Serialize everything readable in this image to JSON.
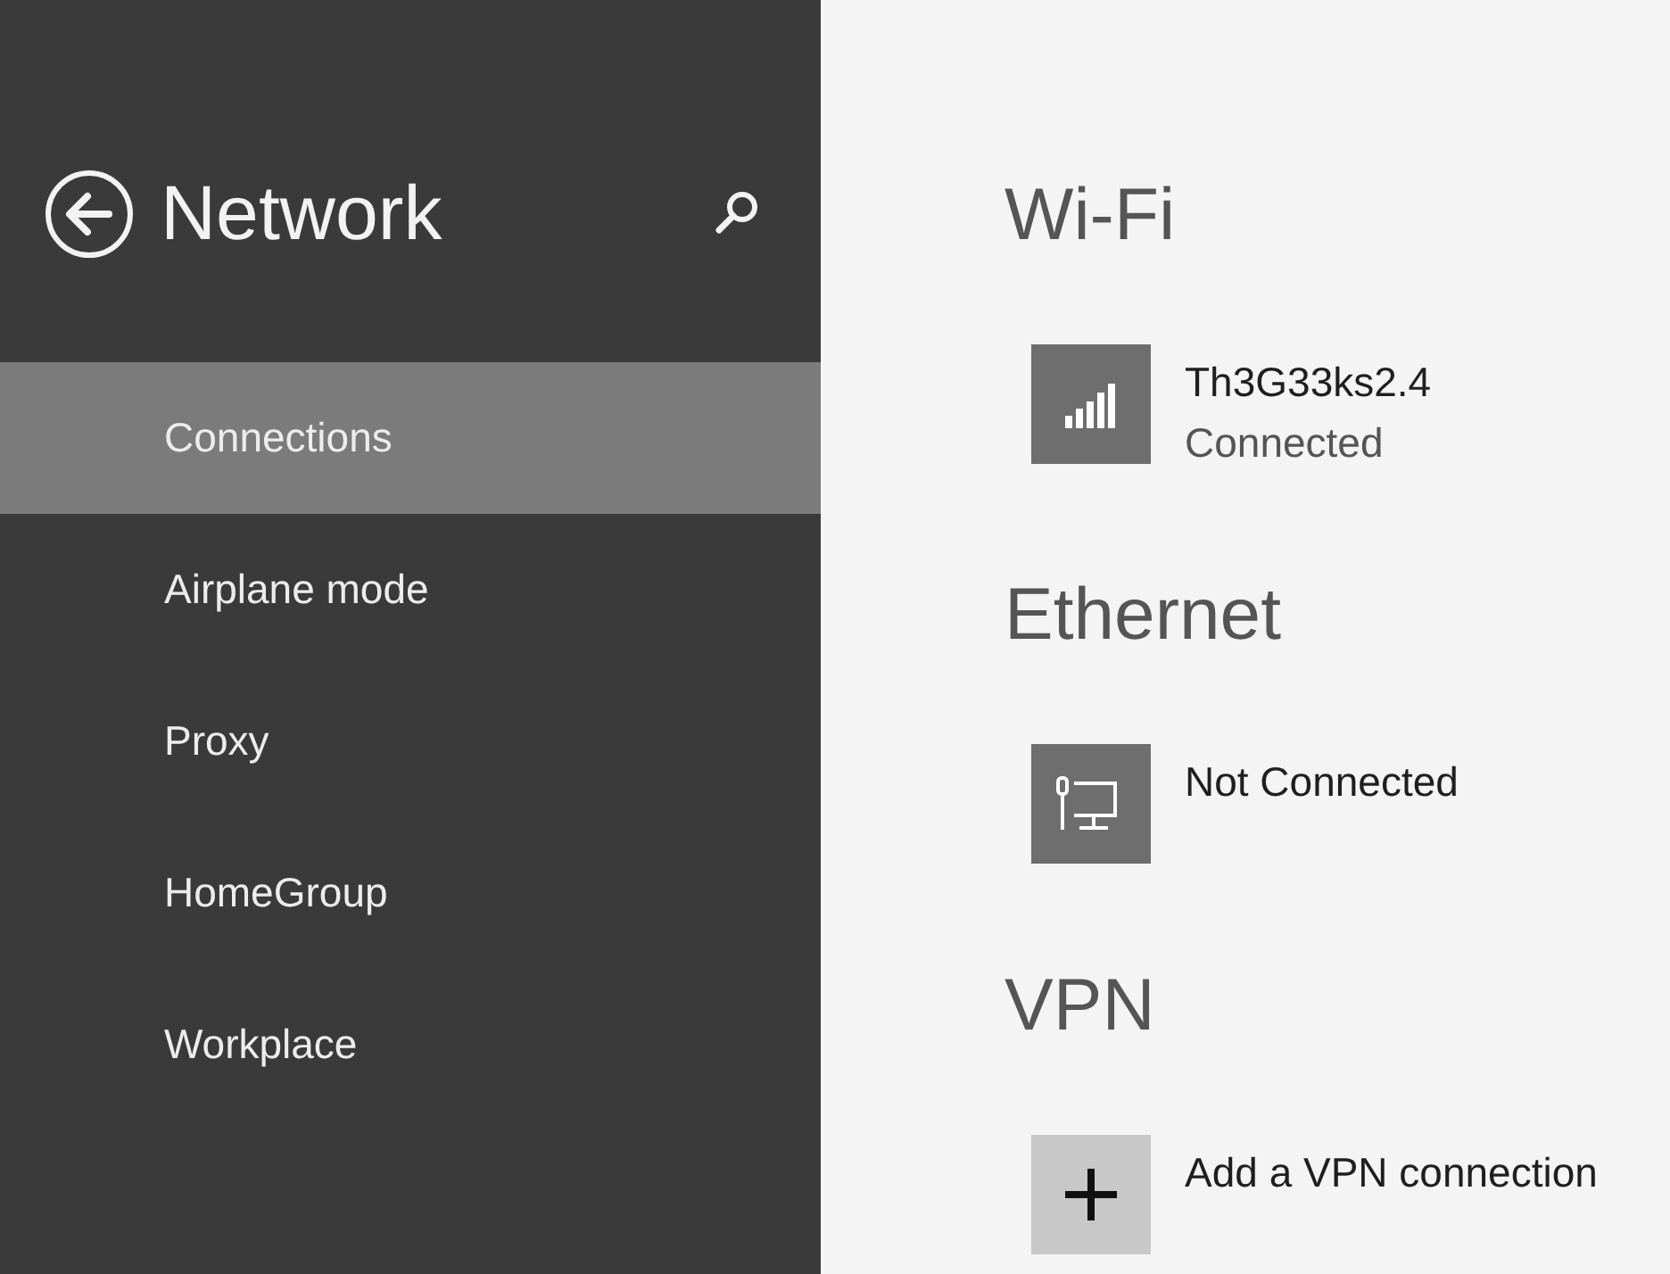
{
  "header": {
    "title": "Network"
  },
  "nav": {
    "items": [
      {
        "label": "Connections",
        "selected": true
      },
      {
        "label": "Airplane mode",
        "selected": false
      },
      {
        "label": "Proxy",
        "selected": false
      },
      {
        "label": "HomeGroup",
        "selected": false
      },
      {
        "label": "Workplace",
        "selected": false
      }
    ]
  },
  "sections": [
    {
      "heading": "Wi-Fi",
      "items": [
        {
          "kind": "wifi",
          "name": "Th3G33ks2.4",
          "status": "Connected"
        }
      ]
    },
    {
      "heading": "Ethernet",
      "items": [
        {
          "kind": "ethernet",
          "status": "Not Connected"
        }
      ]
    },
    {
      "heading": "VPN",
      "items": [
        {
          "kind": "add",
          "name": "Add a VPN connection"
        }
      ]
    }
  ]
}
